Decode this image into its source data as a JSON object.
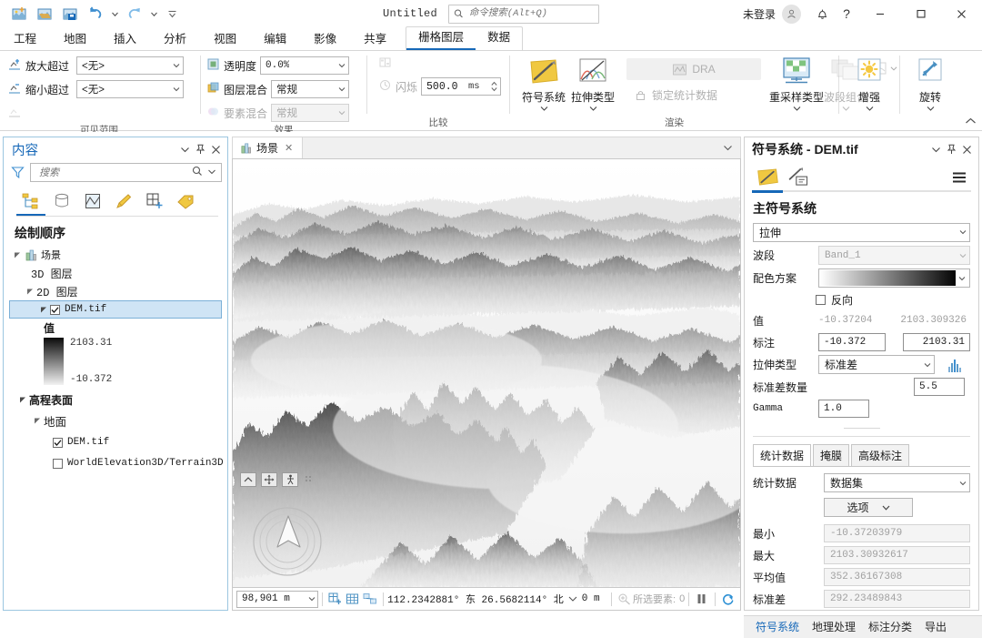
{
  "titlebar": {
    "quick_access": [
      {
        "name": "new-project-icon",
        "label": "新建"
      },
      {
        "name": "open-project-icon",
        "label": "打开"
      },
      {
        "name": "save-project-icon",
        "label": "保存"
      },
      {
        "name": "undo-icon",
        "label": "撤销"
      },
      {
        "name": "redo-icon",
        "label": "重做"
      },
      {
        "name": "customize-quick-access-icon",
        "label": "自定义快速访问工具栏"
      }
    ],
    "doc_title": "Untitled",
    "search_placeholder": "命令搜索(Alt+Q)",
    "sign_in": "未登录",
    "notifications_label": "通知",
    "help_label": "?",
    "minimize": "–",
    "maximize": "☐",
    "close": "✕"
  },
  "ribbon": {
    "tabs": [
      "工程",
      "地图",
      "插入",
      "分析",
      "视图",
      "编辑",
      "影像",
      "共享"
    ],
    "contextual_tabs": [
      {
        "label": "栅格图层",
        "active": true
      },
      {
        "label": "数据",
        "active": false
      }
    ],
    "groups": [
      {
        "name": "visible-range",
        "label": "可见范围",
        "rows": [
          {
            "label": "放大超过",
            "value": "<无>"
          },
          {
            "label": "缩小超过",
            "value": "<无>"
          }
        ]
      },
      {
        "name": "effects",
        "label": "效果",
        "rows": [
          {
            "label": "透明度",
            "value": "0.0%"
          },
          {
            "label": "图层混合",
            "value": "常规"
          },
          {
            "label": "要素混合",
            "value": "常规",
            "disabled": true
          }
        ]
      },
      {
        "name": "compare",
        "label": "比较",
        "rows": [
          {
            "label": "闪烁",
            "value": "500.0",
            "unit": "ms",
            "disabled": true
          }
        ]
      },
      {
        "name": "render",
        "label": "渲染",
        "buttons": [
          {
            "label": "符号系统",
            "icon": "symbology-icon",
            "disabled": false
          },
          {
            "label": "拉伸类型",
            "icon": "stretch-type-icon",
            "disabled": false
          },
          {
            "label": "DRA",
            "icon": "dra-icon",
            "disabled": true
          },
          {
            "label": "锁定统计数据",
            "icon": "lock-icon",
            "disabled": true
          },
          {
            "label": "重采样类型",
            "icon": "resample-icon",
            "disabled": false
          },
          {
            "label": "波段组合",
            "icon": "band-combination-icon",
            "disabled": true
          }
        ]
      },
      {
        "name": "enhance-rotate",
        "label": "",
        "buttons": [
          {
            "label": "增强",
            "icon": "enhance-icon",
            "disabled": false
          },
          {
            "label": "旋转",
            "icon": "rotate-icon",
            "disabled": false
          }
        ]
      }
    ]
  },
  "contents_panel": {
    "title": "内容",
    "search_placeholder": "搜索",
    "toolbar_icons": [
      "list-by-drawing-order-icon",
      "list-by-data-source-icon",
      "list-by-selection-icon",
      "list-by-editing-icon",
      "list-by-snapping-icon",
      "list-by-labeling-icon"
    ],
    "toc_heading": "绘制顺序",
    "tree": {
      "scene_label": "场景",
      "layers_3d": "3D 图层",
      "layers_2d": "2D 图层",
      "raster_layer": "DEM.tif",
      "value_label": "值",
      "legend_max": "2103.31",
      "legend_min": "-10.372",
      "elevation_surfaces": "高程表面",
      "ground": "地面",
      "ground_layer_1": "DEM.tif",
      "ground_layer_2": "WorldElevation3D/Terrain3D"
    }
  },
  "view": {
    "tab_label": "场景",
    "nav_buttons": [
      "full-extent-icon",
      "pan-icon",
      "explore-icon"
    ],
    "navigator_label": "navigator-control"
  },
  "statusbar": {
    "scale": "98,901 m",
    "icons": [
      "add-data-icon",
      "grid-icon",
      "select-icon"
    ],
    "coordinates": "112.2342881° 东 26.5682114° 北",
    "elevation": "0 m",
    "selected_features_label": "所选要素:",
    "selected_features_count": "0",
    "pause_label": "pause-drawing-icon",
    "refresh_label": "refresh-icon"
  },
  "symbology_panel": {
    "title": "符号系统 - DEM.tif",
    "tabs": [
      "primary-symbology-icon",
      "mask-symbology-icon"
    ],
    "menu_icon": "hamburger-menu-icon",
    "section_title": "主符号系统",
    "primary_symbology": "拉伸",
    "fields": {
      "band_label": "波段",
      "band_value": "Band_1",
      "color_scheme_label": "配色方案",
      "invert_label": "反向",
      "invert_checked": false,
      "value_label": "值",
      "value_min": "-10.37204",
      "value_max": "2103.309326",
      "label_label": "标注",
      "label_min": "-10.372",
      "label_max": "2103.31",
      "stretch_type_label": "拉伸类型",
      "stretch_type_value": "标准差",
      "stddev_label": "标准差数量",
      "stddev_value": "5.5",
      "gamma_label": "Gamma",
      "gamma_value": "1.0"
    },
    "sub_tabs": [
      {
        "label": "统计数据",
        "active": true
      },
      {
        "label": "掩膜",
        "active": false
      },
      {
        "label": "高级标注",
        "active": false
      }
    ],
    "statistics": {
      "source_label": "统计数据",
      "source_value": "数据集",
      "options_button": "选项",
      "min_label": "最小",
      "min_value": "-10.37203979",
      "max_label": "最大",
      "max_value": "2103.30932617",
      "mean_label": "平均值",
      "mean_value": "352.36167308",
      "std_label": "标准差",
      "std_value": "292.23489843"
    }
  },
  "bottom_tabs": [
    {
      "label": "符号系统",
      "active": true
    },
    {
      "label": "地理处理",
      "active": false
    },
    {
      "label": "标注分类",
      "active": false
    },
    {
      "label": "导出",
      "active": false
    }
  ],
  "colors": {
    "accent": "#1668b8",
    "panel_border": "#9cc6e0",
    "ribbon_bg": "#ffffff"
  }
}
